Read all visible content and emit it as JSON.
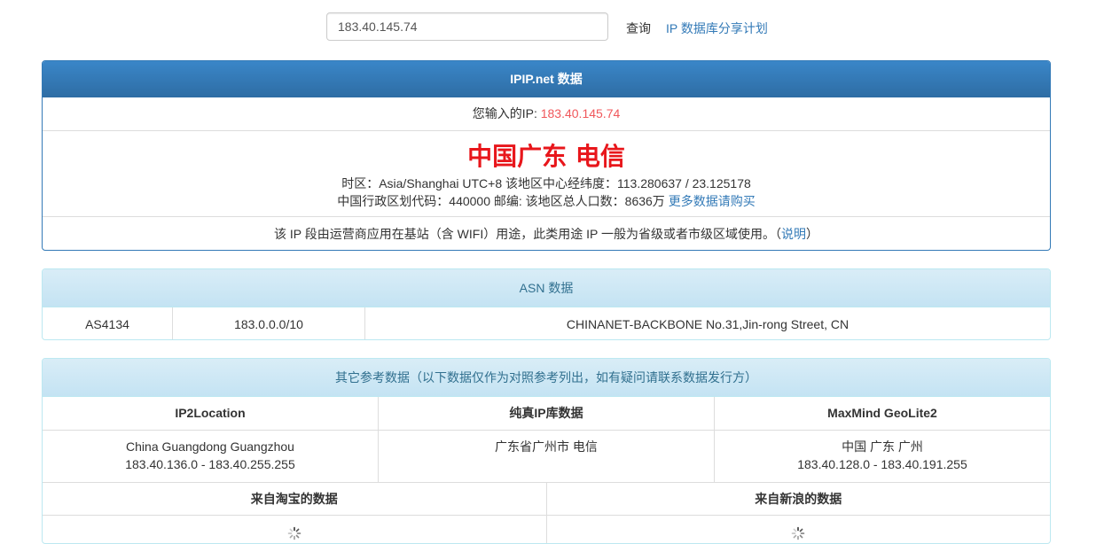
{
  "search": {
    "value": "183.40.145.74",
    "query_label": "查询",
    "share_label": "IP 数据库分享计划"
  },
  "ipip": {
    "title": "IPIP.net 数据",
    "input_label": "您输入的IP: ",
    "input_ip": "183.40.145.74",
    "location": "中国广东 电信",
    "meta_line1": "时区：Asia/Shanghai UTC+8 该地区中心经纬度：113.280637 / 23.125178",
    "meta_line2": "中国行政区划代码：440000 邮编: 该地区总人口数：8636万 ",
    "buy_link": "更多数据请购买",
    "note_text": "该 IP 段由运营商应用在基站（含 WIFI）用途，此类用途 IP 一般为省级或者市级区域使用。（",
    "note_link": "说明",
    "note_end": "）"
  },
  "asn": {
    "title": "ASN 数据",
    "number": "AS4134",
    "prefix": "183.0.0.0/10",
    "name": "CHINANET-BACKBONE No.31,Jin-rong Street, CN"
  },
  "other": {
    "title": "其它参考数据（以下数据仅作为对照参考列出，如有疑问请联系数据发行方）",
    "sources": [
      {
        "name": "IP2Location",
        "line1": "China Guangdong Guangzhou",
        "line2": "183.40.136.0 - 183.40.255.255"
      },
      {
        "name": "纯真IP库数据",
        "line1": "广东省广州市 电信",
        "line2": ""
      },
      {
        "name": "MaxMind GeoLite2",
        "line1": "中国 广东 广州",
        "line2": "183.40.128.0 - 183.40.191.255"
      }
    ],
    "taobao_label": "来自淘宝的数据",
    "sina_label": "来自新浪的数据"
  },
  "colors": {
    "primary": "#337ab7",
    "location_red": "#e8161b",
    "ip_red": "#f0575b",
    "info_text": "#31708f",
    "info_bg": "#d9edf7"
  },
  "icons": {
    "loading": "spinner-icon"
  }
}
